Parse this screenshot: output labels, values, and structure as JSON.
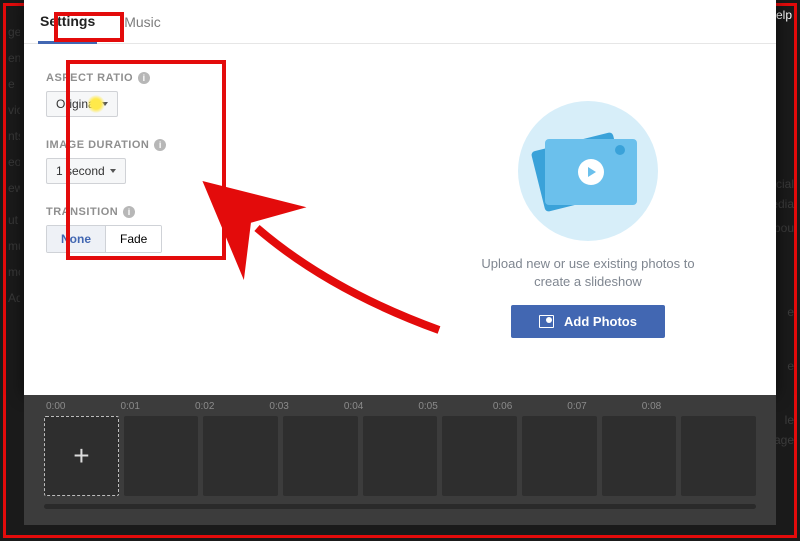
{
  "top_right": {
    "help": "Help"
  },
  "bg_left": [
    "ge",
    "enn",
    "e",
    "vices",
    "nts",
    "eos",
    "ewo",
    "",
    "ut",
    "mun",
    "motio",
    "Ad C"
  ],
  "bg_right": [
    "ocial",
    "edia",
    "abou",
    "e",
    "e",
    "le",
    "Page"
  ],
  "tabs": {
    "settings": "Settings",
    "music": "Music"
  },
  "settings": {
    "aspect_ratio": {
      "label": "ASPECT RATIO",
      "value": "Original"
    },
    "image_duration": {
      "label": "IMAGE DURATION",
      "value": "1 second"
    },
    "transition": {
      "label": "TRANSITION",
      "none": "None",
      "fade": "Fade"
    }
  },
  "right": {
    "help_text": "Upload new or use existing photos to create a slideshow",
    "button": "Add Photos"
  },
  "timeline": {
    "labels": [
      "0:00",
      "0:01",
      "0:02",
      "0:03",
      "0:04",
      "0:05",
      "0:06",
      "0:07",
      "0:08"
    ],
    "add": "+"
  }
}
